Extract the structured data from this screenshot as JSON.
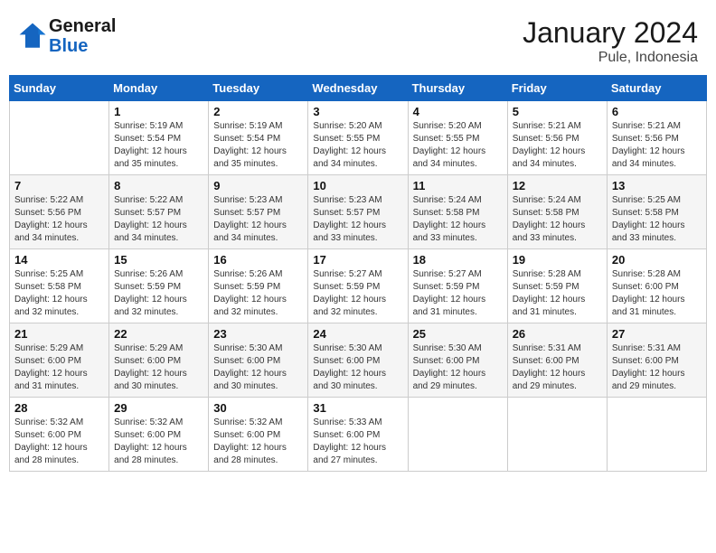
{
  "header": {
    "logo_line1": "General",
    "logo_line2": "Blue",
    "month_year": "January 2024",
    "location": "Pule, Indonesia"
  },
  "days_of_week": [
    "Sunday",
    "Monday",
    "Tuesday",
    "Wednesday",
    "Thursday",
    "Friday",
    "Saturday"
  ],
  "weeks": [
    [
      {
        "day": "",
        "info": ""
      },
      {
        "day": "1",
        "info": "Sunrise: 5:19 AM\nSunset: 5:54 PM\nDaylight: 12 hours\nand 35 minutes."
      },
      {
        "day": "2",
        "info": "Sunrise: 5:19 AM\nSunset: 5:54 PM\nDaylight: 12 hours\nand 35 minutes."
      },
      {
        "day": "3",
        "info": "Sunrise: 5:20 AM\nSunset: 5:55 PM\nDaylight: 12 hours\nand 34 minutes."
      },
      {
        "day": "4",
        "info": "Sunrise: 5:20 AM\nSunset: 5:55 PM\nDaylight: 12 hours\nand 34 minutes."
      },
      {
        "day": "5",
        "info": "Sunrise: 5:21 AM\nSunset: 5:56 PM\nDaylight: 12 hours\nand 34 minutes."
      },
      {
        "day": "6",
        "info": "Sunrise: 5:21 AM\nSunset: 5:56 PM\nDaylight: 12 hours\nand 34 minutes."
      }
    ],
    [
      {
        "day": "7",
        "info": "Sunrise: 5:22 AM\nSunset: 5:56 PM\nDaylight: 12 hours\nand 34 minutes."
      },
      {
        "day": "8",
        "info": "Sunrise: 5:22 AM\nSunset: 5:57 PM\nDaylight: 12 hours\nand 34 minutes."
      },
      {
        "day": "9",
        "info": "Sunrise: 5:23 AM\nSunset: 5:57 PM\nDaylight: 12 hours\nand 34 minutes."
      },
      {
        "day": "10",
        "info": "Sunrise: 5:23 AM\nSunset: 5:57 PM\nDaylight: 12 hours\nand 33 minutes."
      },
      {
        "day": "11",
        "info": "Sunrise: 5:24 AM\nSunset: 5:58 PM\nDaylight: 12 hours\nand 33 minutes."
      },
      {
        "day": "12",
        "info": "Sunrise: 5:24 AM\nSunset: 5:58 PM\nDaylight: 12 hours\nand 33 minutes."
      },
      {
        "day": "13",
        "info": "Sunrise: 5:25 AM\nSunset: 5:58 PM\nDaylight: 12 hours\nand 33 minutes."
      }
    ],
    [
      {
        "day": "14",
        "info": "Sunrise: 5:25 AM\nSunset: 5:58 PM\nDaylight: 12 hours\nand 32 minutes."
      },
      {
        "day": "15",
        "info": "Sunrise: 5:26 AM\nSunset: 5:59 PM\nDaylight: 12 hours\nand 32 minutes."
      },
      {
        "day": "16",
        "info": "Sunrise: 5:26 AM\nSunset: 5:59 PM\nDaylight: 12 hours\nand 32 minutes."
      },
      {
        "day": "17",
        "info": "Sunrise: 5:27 AM\nSunset: 5:59 PM\nDaylight: 12 hours\nand 32 minutes."
      },
      {
        "day": "18",
        "info": "Sunrise: 5:27 AM\nSunset: 5:59 PM\nDaylight: 12 hours\nand 31 minutes."
      },
      {
        "day": "19",
        "info": "Sunrise: 5:28 AM\nSunset: 5:59 PM\nDaylight: 12 hours\nand 31 minutes."
      },
      {
        "day": "20",
        "info": "Sunrise: 5:28 AM\nSunset: 6:00 PM\nDaylight: 12 hours\nand 31 minutes."
      }
    ],
    [
      {
        "day": "21",
        "info": "Sunrise: 5:29 AM\nSunset: 6:00 PM\nDaylight: 12 hours\nand 31 minutes."
      },
      {
        "day": "22",
        "info": "Sunrise: 5:29 AM\nSunset: 6:00 PM\nDaylight: 12 hours\nand 30 minutes."
      },
      {
        "day": "23",
        "info": "Sunrise: 5:30 AM\nSunset: 6:00 PM\nDaylight: 12 hours\nand 30 minutes."
      },
      {
        "day": "24",
        "info": "Sunrise: 5:30 AM\nSunset: 6:00 PM\nDaylight: 12 hours\nand 30 minutes."
      },
      {
        "day": "25",
        "info": "Sunrise: 5:30 AM\nSunset: 6:00 PM\nDaylight: 12 hours\nand 29 minutes."
      },
      {
        "day": "26",
        "info": "Sunrise: 5:31 AM\nSunset: 6:00 PM\nDaylight: 12 hours\nand 29 minutes."
      },
      {
        "day": "27",
        "info": "Sunrise: 5:31 AM\nSunset: 6:00 PM\nDaylight: 12 hours\nand 29 minutes."
      }
    ],
    [
      {
        "day": "28",
        "info": "Sunrise: 5:32 AM\nSunset: 6:00 PM\nDaylight: 12 hours\nand 28 minutes."
      },
      {
        "day": "29",
        "info": "Sunrise: 5:32 AM\nSunset: 6:00 PM\nDaylight: 12 hours\nand 28 minutes."
      },
      {
        "day": "30",
        "info": "Sunrise: 5:32 AM\nSunset: 6:00 PM\nDaylight: 12 hours\nand 28 minutes."
      },
      {
        "day": "31",
        "info": "Sunrise: 5:33 AM\nSunset: 6:00 PM\nDaylight: 12 hours\nand 27 minutes."
      },
      {
        "day": "",
        "info": ""
      },
      {
        "day": "",
        "info": ""
      },
      {
        "day": "",
        "info": ""
      }
    ]
  ]
}
